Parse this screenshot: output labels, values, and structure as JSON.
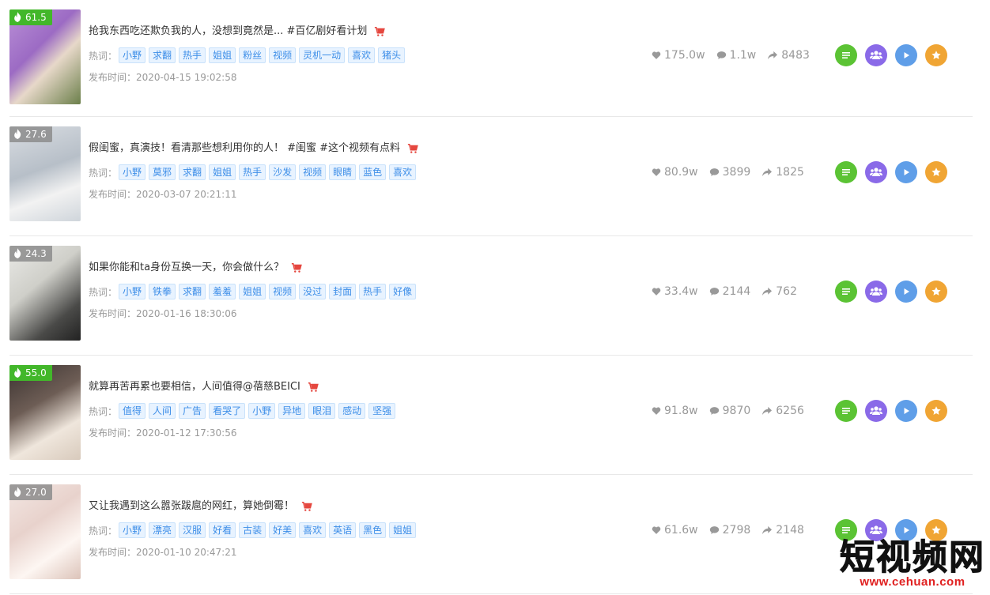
{
  "stats_icons": {
    "like": "heart-icon",
    "comment": "comment-icon",
    "share": "share-arrow-icon"
  },
  "labels": {
    "hot_words": "热词：",
    "publish_prefix": "发布时间："
  },
  "actions": [
    "detail-list-icon",
    "fans-icon",
    "play-icon",
    "star-icon"
  ],
  "colors": {
    "tag_bg": "#e8f3ff",
    "tag_text": "#3d8ee8",
    "heat_green": "#42b72a",
    "cart_red": "#e5473f",
    "btn_green": "#5bc334",
    "btn_purple": "#8a6ae8",
    "btn_blue": "#5f9ee8",
    "btn_orange": "#f0a534"
  },
  "items": [
    {
      "heat": "61.5",
      "heat_style": "green",
      "title": "抢我东西吃还欺负我的人，没想到竟然是... #百亿剧好看计划",
      "tags": [
        "小野",
        "求翻",
        "热手",
        "姐姐",
        "粉丝",
        "视频",
        "灵机一动",
        "喜欢",
        "猪头"
      ],
      "publish_time": "2020-04-15 19:02:58",
      "likes": "175.0w",
      "comments": "1.1w",
      "shares": "8483"
    },
    {
      "heat": "27.6",
      "heat_style": "gray",
      "title": "假闺蜜，真演技！看清那些想利用你的人！ #闺蜜 #这个视频有点料",
      "tags": [
        "小野",
        "莫邪",
        "求翻",
        "姐姐",
        "热手",
        "沙发",
        "视频",
        "眼睛",
        "蓝色",
        "喜欢"
      ],
      "publish_time": "2020-03-07 20:21:11",
      "likes": "80.9w",
      "comments": "3899",
      "shares": "1825"
    },
    {
      "heat": "24.3",
      "heat_style": "gray",
      "title": "如果你能和ta身份互换一天，你会做什么？",
      "tags": [
        "小野",
        "铁拳",
        "求翻",
        "羞羞",
        "姐姐",
        "视频",
        "没过",
        "封面",
        "热手",
        "好像"
      ],
      "publish_time": "2020-01-16 18:30:06",
      "likes": "33.4w",
      "comments": "2144",
      "shares": "762"
    },
    {
      "heat": "55.0",
      "heat_style": "green",
      "title": "就算再苦再累也要相信，人间值得@蓓慈BEICI",
      "tags": [
        "值得",
        "人间",
        "广告",
        "看哭了",
        "小野",
        "异地",
        "眼泪",
        "感动",
        "坚强"
      ],
      "publish_time": "2020-01-12 17:30:56",
      "likes": "91.8w",
      "comments": "9870",
      "shares": "6256"
    },
    {
      "heat": "27.0",
      "heat_style": "gray",
      "title": "又让我遇到这么嚣张跋扈的网红，算她倒霉！",
      "tags": [
        "小野",
        "漂亮",
        "汉服",
        "好看",
        "古装",
        "好美",
        "喜欢",
        "英语",
        "黑色",
        "姐姐"
      ],
      "publish_time": "2020-01-10 20:47:21",
      "likes": "61.6w",
      "comments": "2798",
      "shares": "2148"
    }
  ],
  "watermark": {
    "title": "短视频网",
    "url": "www.cehuan.com"
  }
}
